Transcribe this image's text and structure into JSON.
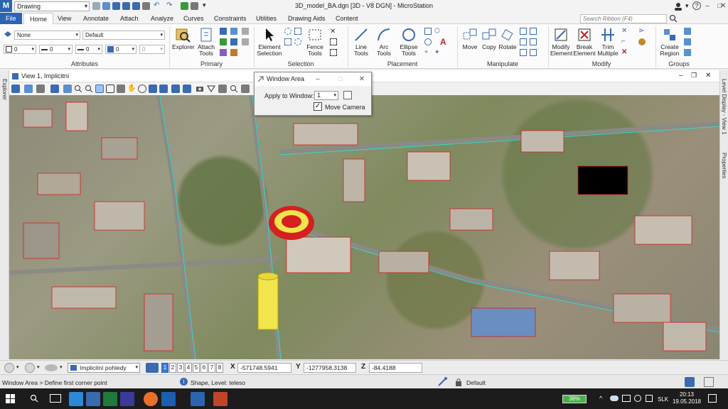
{
  "app": {
    "logo_text": "M",
    "workspace": "Drawing",
    "title": "3D_model_BA.dgn [3D - V8 DGN] - MicroStation",
    "search_placeholder": "Search Ribbon (F4)",
    "accent_color": "#2b64b0"
  },
  "tabs": [
    "File",
    "Home",
    "View",
    "Annotate",
    "Attach",
    "Analyze",
    "Curves",
    "Constraints",
    "Utilities",
    "Drawing Aids",
    "Content"
  ],
  "ribbon": {
    "attributes": {
      "label": "Attributes",
      "level": "None",
      "style": "Default",
      "color": "0",
      "weight": "0",
      "line": "0",
      "fill": "0",
      "trans": "0",
      "prio": "0"
    },
    "primary": {
      "label": "Primary",
      "explorer": "Explorer",
      "attach_tools": "Attach Tools"
    },
    "selection": {
      "label": "Selection",
      "element_selection": "Element Selection",
      "fence_tools": "Fence Tools"
    },
    "placement": {
      "label": "Placement",
      "line_tools": "Line Tools",
      "arc_tools": "Arc Tools",
      "ellipse_tools": "Ellipse Tools"
    },
    "manipulate": {
      "label": "Manipulate",
      "move": "Move",
      "copy": "Copy",
      "rotate": "Rotate"
    },
    "modify": {
      "label": "Modify",
      "modify_element": "Modify Element",
      "break_element": "Break Element",
      "trim_multiple": "Trim Multiple"
    },
    "groups": {
      "label": "Groups",
      "create_region": "Create Region"
    }
  },
  "view": {
    "title": "View 1, Implicitní",
    "explorer_tab": "Explorer",
    "right_tabs": [
      "Level Display - View 1",
      "Properties"
    ]
  },
  "dialog": {
    "title": "Window Area",
    "apply_label": "Apply to Window:",
    "apply_value": "1",
    "move_camera_label": "Move Camera",
    "move_camera_checked": true
  },
  "viewbar": {
    "view_combo": "Implicitní pohledy",
    "views": [
      "1",
      "2",
      "3",
      "4",
      "5",
      "6",
      "7",
      "8"
    ],
    "active_view": "1",
    "x_label": "X",
    "x_value": "-571748.5941",
    "y_label": "Y",
    "y_value": "-1277958.3138",
    "z_label": "Z",
    "z_value": "-84.4188"
  },
  "statusbar": {
    "prompt": "Window Area > Define first corner point",
    "message": "Shape, Level: teleso",
    "active_level": "Default"
  },
  "taskbar": {
    "battery": "38%",
    "language": "SLK",
    "time": "20:13",
    "date": "19.05.2018"
  }
}
